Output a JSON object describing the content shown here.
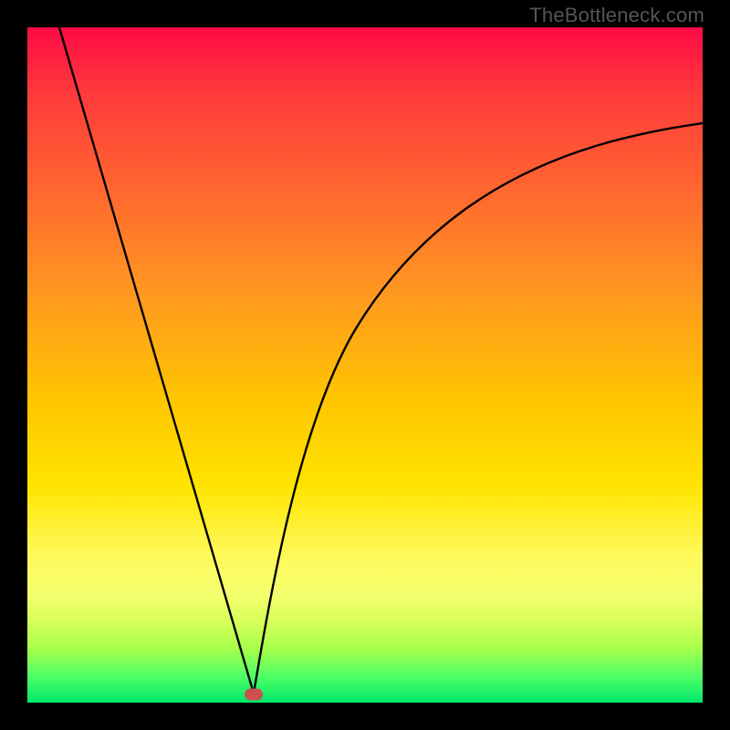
{
  "watermark": "TheBottleneck.com",
  "colors": {
    "frame": "#000000",
    "top": "#ff0a46",
    "bottom": "#00e86a",
    "curve": "#000000",
    "marker": "#c9524f"
  },
  "chart_data": {
    "type": "line",
    "title": "",
    "xlabel": "",
    "ylabel": "",
    "xlim": [
      0,
      100
    ],
    "ylim": [
      0,
      100
    ],
    "grid": false,
    "legend": false,
    "annotations": [
      {
        "text": "TheBottleneck.com",
        "position": "top-right",
        "color": "#555555"
      }
    ],
    "series": [
      {
        "name": "left-branch",
        "x": [
          0,
          6,
          12,
          18,
          24,
          30,
          33.5
        ],
        "y": [
          99,
          82,
          64,
          47,
          29,
          12,
          1
        ]
      },
      {
        "name": "right-branch",
        "x": [
          33.5,
          38,
          44,
          52,
          60,
          70,
          80,
          90,
          100
        ],
        "y": [
          1,
          18,
          38,
          54,
          65,
          73,
          79,
          83,
          86
        ]
      }
    ],
    "marker": {
      "x": 33.5,
      "y": 1
    },
    "notes": "V-shaped bottleneck curve over a vertical spectrum gradient; minimum sits on green band near x≈33% with a small rounded marker."
  }
}
